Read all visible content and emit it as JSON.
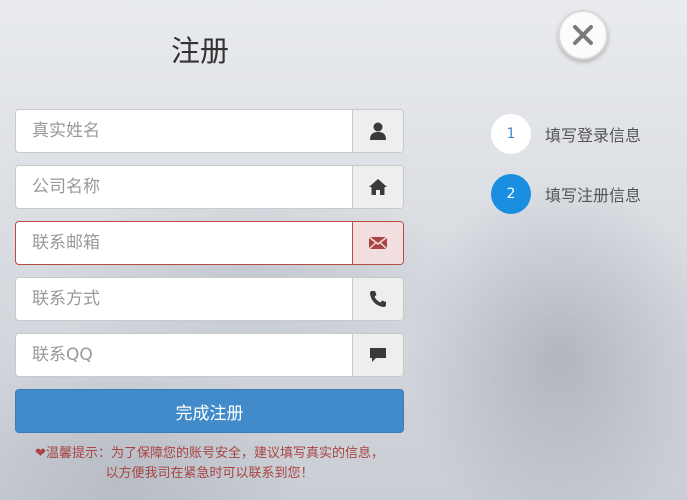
{
  "title": "注册",
  "close_icon": "close-icon",
  "fields": [
    {
      "placeholder": "真实姓名",
      "icon": "user-icon",
      "state": "normal"
    },
    {
      "placeholder": "公司名称",
      "icon": "home-icon",
      "state": "normal"
    },
    {
      "placeholder": "联系邮箱",
      "icon": "envelope-icon",
      "state": "error"
    },
    {
      "placeholder": "联系方式",
      "icon": "phone-icon",
      "state": "normal"
    },
    {
      "placeholder": "联系QQ",
      "icon": "comment-icon",
      "state": "normal"
    }
  ],
  "submit_label": "完成注册",
  "tip": {
    "line1": "温馨提示：为了保障您的账号安全，建议填写真实的信息，",
    "line2": "以方便我司在紧急时可以联系到您！",
    "icon": "heart-icon"
  },
  "steps": [
    {
      "number": "1",
      "label": "填写登录信息",
      "active": false
    },
    {
      "number": "2",
      "label": "填写注册信息",
      "active": true
    }
  ],
  "colors": {
    "primary": "#428bca",
    "active_step": "#1a8ee1",
    "error": "#b94a48",
    "tip_text": "#a94442"
  }
}
